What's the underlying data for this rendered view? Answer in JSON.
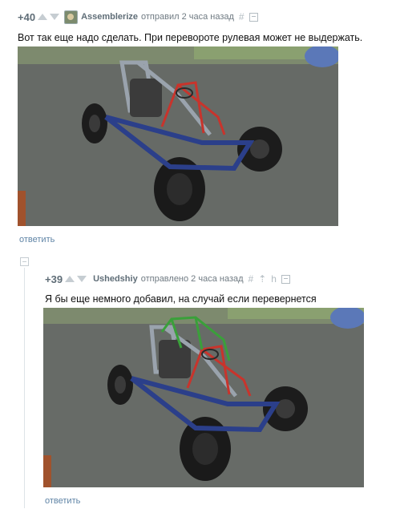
{
  "comments": [
    {
      "rating": "+40",
      "author": "Assemblerize",
      "meta": "отправил 2 часа назад",
      "hash_icon": "#",
      "text": "Вот так еще надо сделать. При перевороте рулевая может не выдержать.",
      "reply_label": "ответить",
      "photo_alt": "buggy-photo"
    },
    {
      "rating": "+39",
      "author": "Ushedshiy",
      "meta": "отправлено 2 часа назад",
      "hash_icon": "#",
      "up_icon": "⇡",
      "branch_icon": "h",
      "text": "Я бы еще немного добавил, на случай если перевернется",
      "reply_label": "ответить",
      "photo_alt": "buggy-photo-modified"
    }
  ],
  "colors": {
    "link": "#5f84a6",
    "meta": "#6f7a82",
    "red_bar": "#c8342c",
    "green_bar": "#3aa03a",
    "frame_blue": "#2b3f8a"
  }
}
